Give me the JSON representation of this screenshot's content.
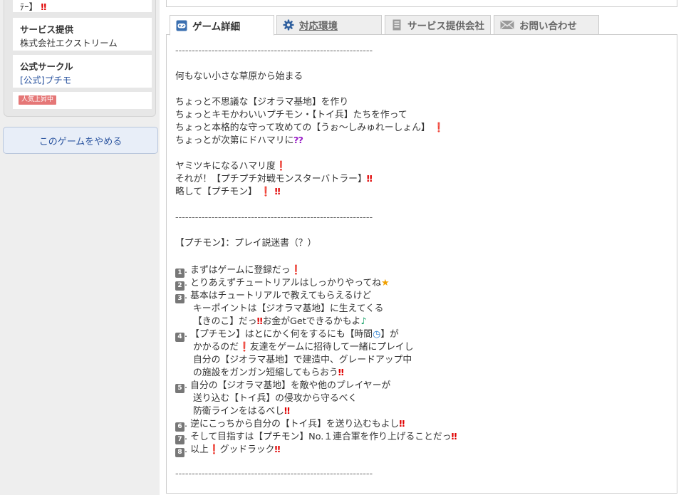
{
  "sidebar": {
    "top_text": "ﾃｰ】",
    "service_title": "サービス提供",
    "service_value": "株式会社エクストリーム",
    "circle_title": "公式サークル",
    "circle_link": "[公式]プチモ",
    "badge": "人気上昇中",
    "quit_button": "このゲームをやめる"
  },
  "tabs": [
    {
      "label": "ゲーム詳細",
      "icon": "game-controller-icon"
    },
    {
      "label": "対応環境",
      "icon": "gear-icon"
    },
    {
      "label": "サービス提供会社",
      "icon": "building-icon"
    },
    {
      "label": "お問い合わせ",
      "icon": "mail-icon"
    }
  ],
  "content": {
    "separator": "------------------------------------------------------------",
    "p1": "何もない小さな草原から始まる",
    "p2": "ちょっと不思議な【ジオラマ基地】を作り",
    "p3": "ちょっとキモかわいいプチモン・【トイ兵】たちを作って",
    "p4": "ちょっと本格的な守って攻めての【うぉ～しみゅれーしょん】",
    "p5": "ちょっとが次第にドハマリに",
    "p6": "ヤミツキになるハマリ度",
    "p7": "それが！【プチプチ対戦モンスターバトラー】",
    "p8": "略して【プチモン】",
    "guide_title": "【プチモン】：プレイ説迷書（？）",
    "steps": [
      {
        "n": "1",
        "text": "まずはゲームに登録だっ"
      },
      {
        "n": "2",
        "text": "とりあえずチュートリアルはしっかりやってね"
      },
      {
        "n": "3",
        "text": "基本はチュートリアルで教えてもらえるけど"
      },
      {
        "n": "",
        "text": "キーポイントは【ジオラマ基地】に生えてくる"
      },
      {
        "n": "",
        "text": "【きのこ】だっ"
      },
      {
        "n": "",
        "text": "お金がGetできるかもよ"
      },
      {
        "n": "4",
        "text": "【プチモン】はとにかく何をするにも【時間"
      },
      {
        "n": "",
        "text": "】が"
      },
      {
        "n": "",
        "text": "かかるのだ"
      },
      {
        "n": "",
        "text": "友達をゲームに招待して一緒にプレイし"
      },
      {
        "n": "",
        "text": "自分の【ジオラマ基地】で建造中、グレードアップ中"
      },
      {
        "n": "",
        "text": "の施設をガンガン短縮してもらおう"
      },
      {
        "n": "5",
        "text": "自分の【ジオラマ基地】を敵や他のプレイヤーが"
      },
      {
        "n": "",
        "text": "送り込む【トイ兵】の侵攻から守るべく"
      },
      {
        "n": "",
        "text": "防衛ラインをはるべし"
      },
      {
        "n": "6",
        "text": "逆にこっちから自分の【トイ兵】を送り込むもよし"
      },
      {
        "n": "7",
        "text": "そして目指すは【プチモン】No.１連合軍を作り上げることだっ"
      },
      {
        "n": "8",
        "text": "以上"
      },
      {
        "n": "",
        "text": "グッドラック"
      }
    ]
  }
}
